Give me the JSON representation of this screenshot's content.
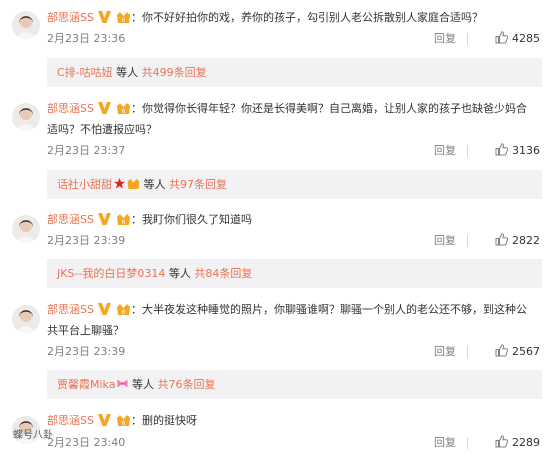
{
  "comments": [
    {
      "username": "部思涵SS",
      "separator": "：",
      "text_lines": [
        "你不好好拍你的戏，养你的孩子，勾引别人老公拆散别人家庭合适吗？"
      ],
      "time": "2月23日 23:36",
      "reply_label": "回复",
      "likes": "4285",
      "replies": {
        "name": "C排-咕咕妞",
        "connector": "等人",
        "count": "共499条回复"
      }
    },
    {
      "username": "部思涵SS",
      "separator": "：",
      "text_lines": [
        "你觉得你长得年轻？你还是长得美啊？自己离婚，让别人家的孩子也缺爸少妈合",
        "适吗？不怕遭报应吗？"
      ],
      "time": "2月23日 23:37",
      "reply_label": "回复",
      "likes": "3136",
      "replies": {
        "name": "话社小甜甜",
        "connector": "等人",
        "count": "共97条回复"
      }
    },
    {
      "username": "部思涵SS",
      "separator": "：",
      "text_lines": [
        "我盯你们很久了知道吗"
      ],
      "time": "2月23日 23:39",
      "reply_label": "回复",
      "likes": "2822",
      "replies": {
        "name": "JKS--我的白日梦0314",
        "connector": "等人",
        "count": "共84条回复"
      }
    },
    {
      "username": "部思涵SS",
      "separator": "：",
      "text_lines": [
        "大半夜发这种睡觉的照片，你聊骚谁啊？聊骚一个别人的老公还不够，到这种公",
        "共平台上聊骚？"
      ],
      "time": "2月23日 23:39",
      "reply_label": "回复",
      "likes": "2567",
      "replies": {
        "name": "贾馨霞Mika",
        "connector": "等人",
        "count": "共76条回复"
      }
    },
    {
      "username": "部思涵SS",
      "separator": "：",
      "text_lines": [
        "删的挺快呀"
      ],
      "time": "2月23日 23:40",
      "reply_label": "回复",
      "likes": "2289"
    }
  ],
  "watermark": "蝶号八卦",
  "colors": {
    "username": "#eb7350",
    "vip_badge": "#f5a623",
    "reply_bg": "#f2f2f5"
  },
  "icons": {
    "verified": "verified-v-icon",
    "vip": "vip-crown-icon",
    "like": "thumbs-up-icon"
  }
}
